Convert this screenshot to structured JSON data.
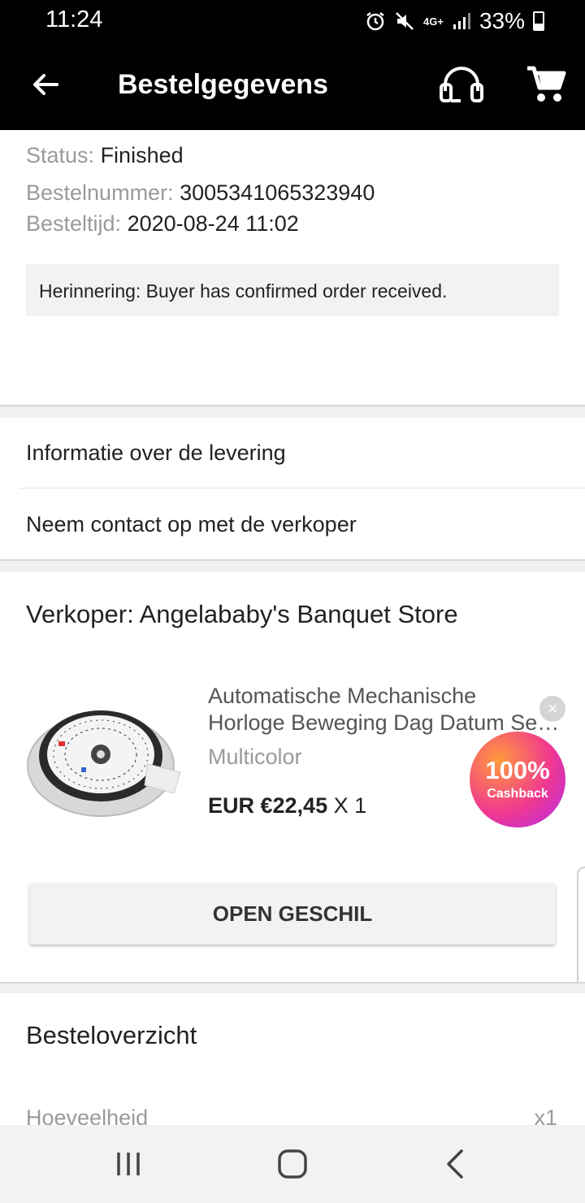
{
  "status_bar": {
    "time": "11:24",
    "network": "4G+",
    "battery": "33%"
  },
  "app_bar": {
    "title": "Bestelgegevens",
    "icons": [
      "back-arrow-icon",
      "headset-icon",
      "cart-icon"
    ]
  },
  "order": {
    "status_label": "Status:",
    "status_value": "Finished",
    "number_label": "Bestelnummer:",
    "number_value": "3005341065323940",
    "time_label": "Besteltijd:",
    "time_value": "2020-08-24 11:02",
    "reminder": "Herinnering: Buyer has confirmed order received."
  },
  "links": {
    "delivery": "Informatie over de levering",
    "contact": "Neem contact op met de verkoper"
  },
  "seller": {
    "label": "Verkoper: Angelababy's Banquet Store"
  },
  "product": {
    "title_line1": "Automatische Mechanische",
    "title_line2": "Horloge Beweging Dag Datum Se…",
    "variant": "Multicolor",
    "price": "EUR €22,45",
    "quantity": "X 1"
  },
  "cashback_badge": {
    "percent": "100%",
    "label": "Cashback",
    "close": "×"
  },
  "dispute_button": "OPEN GESCHIL",
  "summary": {
    "title": "Besteloverzicht",
    "quantity_label": "Hoeveelheid",
    "quantity_value": "x1"
  },
  "nav_bar": {
    "icons": [
      "recent-apps-icon",
      "home-icon",
      "back-icon"
    ]
  },
  "colors": {
    "bar_bg": "#000000",
    "section_bg": "#ffffff",
    "separator_bg": "#f0f0f0",
    "muted_text": "#9a9a9a"
  }
}
